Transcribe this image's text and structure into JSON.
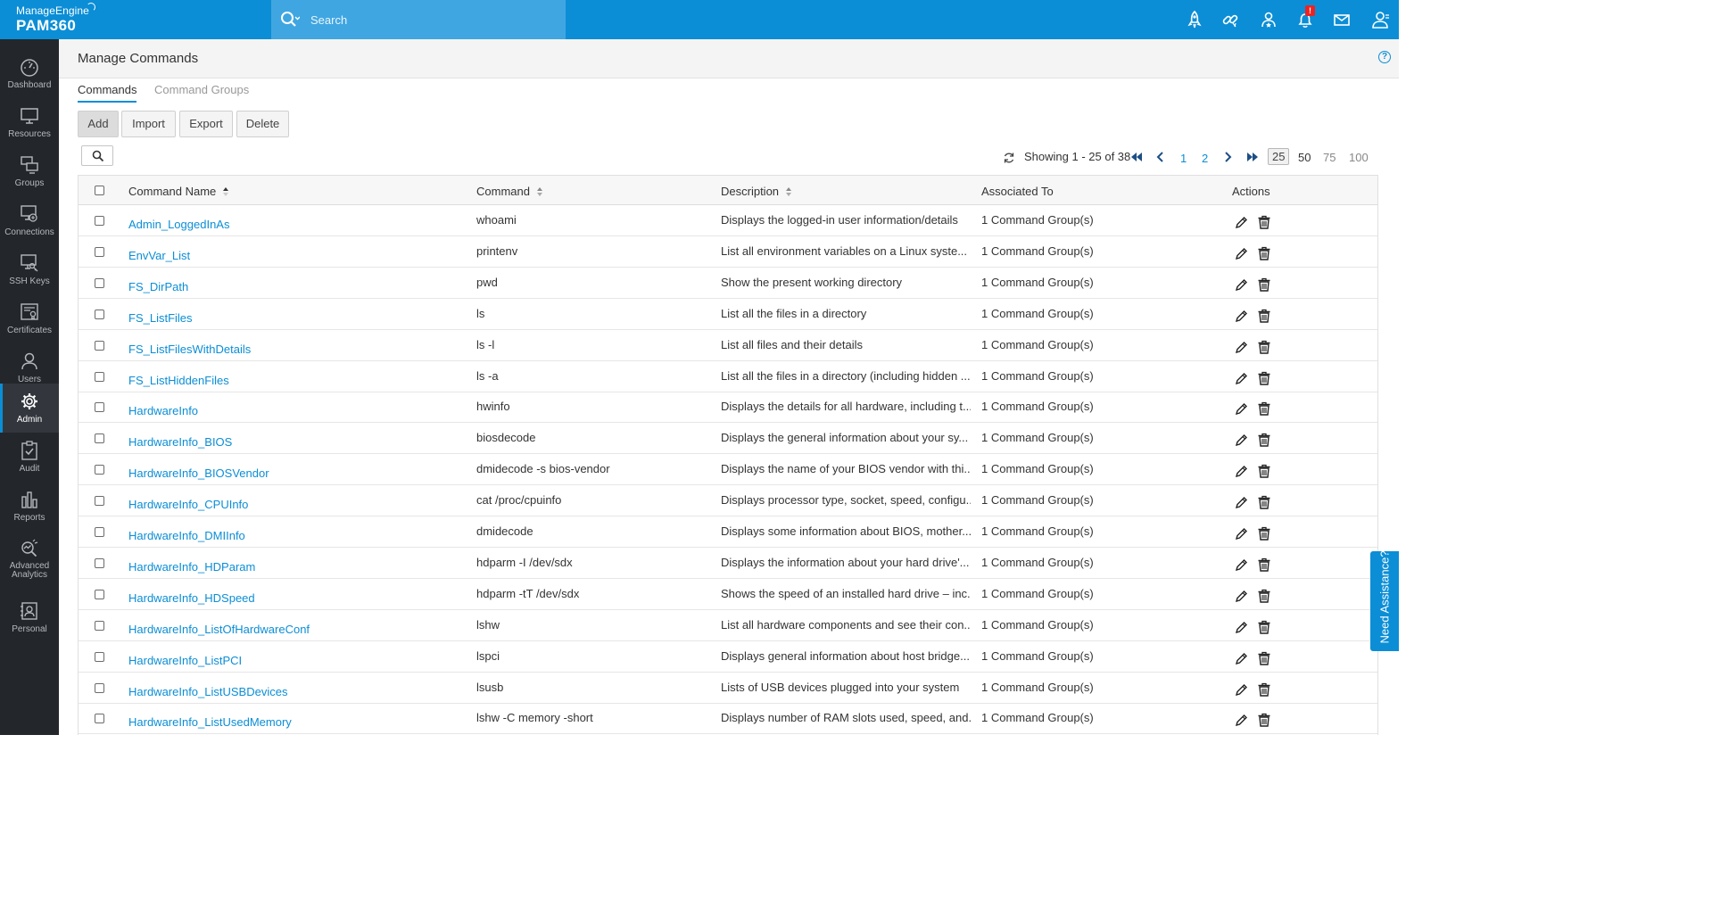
{
  "app": {
    "vendor": "ManageEngine",
    "product": "PAM360",
    "search_placeholder": "Search",
    "notification_count": "!"
  },
  "topbar_icons": [
    "rocket-icon",
    "link-icon",
    "user-star-icon",
    "bell-icon",
    "mail-icon",
    "user-icon"
  ],
  "sidebar": {
    "items": [
      {
        "label": "Dashboard",
        "icon": "dashboard-icon",
        "active": false
      },
      {
        "label": "Resources",
        "icon": "monitor-icon",
        "active": false
      },
      {
        "label": "Groups",
        "icon": "groups-icon",
        "active": false
      },
      {
        "label": "Connections",
        "icon": "connections-icon",
        "active": false
      },
      {
        "label": "SSH Keys",
        "icon": "ssh-keys-icon",
        "active": false
      },
      {
        "label": "Certificates",
        "icon": "certificate-icon",
        "active": false
      },
      {
        "label": "Users",
        "icon": "users-icon",
        "active": false
      },
      {
        "label": "Admin",
        "icon": "gear-icon",
        "active": true
      },
      {
        "label": "Audit",
        "icon": "clipboard-check-icon",
        "active": false
      },
      {
        "label": "Reports",
        "icon": "bar-chart-icon",
        "active": false
      },
      {
        "label": "Advanced Analytics",
        "icon": "analytics-icon",
        "active": false
      },
      {
        "label": "Personal",
        "icon": "personal-icon",
        "active": false
      }
    ]
  },
  "page": {
    "title": "Manage Commands",
    "help": "?",
    "tabs": [
      {
        "label": "Commands",
        "active": true
      },
      {
        "label": "Command Groups",
        "active": false
      }
    ],
    "buttons": {
      "add": "Add",
      "import": "Import",
      "export": "Export",
      "delete": "Delete"
    }
  },
  "pagination": {
    "showing": "Showing 1 - 25 of 38",
    "pages": [
      "1",
      "2"
    ],
    "page_sizes": [
      "25",
      "50",
      "75",
      "100"
    ],
    "current_size": "25"
  },
  "table": {
    "columns": {
      "name": "Command Name",
      "command": "Command",
      "description": "Description",
      "associated": "Associated To",
      "actions": "Actions"
    },
    "rows": [
      {
        "name": "Admin_LoggedInAs",
        "command": "whoami",
        "description": "Displays the logged-in user information/details",
        "associated": "1 Command Group(s)"
      },
      {
        "name": "EnvVar_List",
        "command": "printenv",
        "description": "List all environment variables on a Linux syste...",
        "associated": "1 Command Group(s)"
      },
      {
        "name": "FS_DirPath",
        "command": "pwd",
        "description": "Show the present working directory",
        "associated": "1 Command Group(s)"
      },
      {
        "name": "FS_ListFiles",
        "command": "ls",
        "description": "List all the files in a directory",
        "associated": "1 Command Group(s)"
      },
      {
        "name": "FS_ListFilesWithDetails",
        "command": "ls -l",
        "description": "List all files and their details",
        "associated": "1 Command Group(s)"
      },
      {
        "name": "FS_ListHiddenFiles",
        "command": "ls -a",
        "description": "List all the files in a directory (including hidden ...",
        "associated": "1 Command Group(s)"
      },
      {
        "name": "HardwareInfo",
        "command": "hwinfo",
        "description": "Displays the details for all hardware, including t...",
        "associated": "1 Command Group(s)"
      },
      {
        "name": "HardwareInfo_BIOS",
        "command": "biosdecode",
        "description": "Displays the general information about your sy...",
        "associated": "1 Command Group(s)"
      },
      {
        "name": "HardwareInfo_BIOSVendor",
        "command": "dmidecode -s bios-vendor",
        "description": "Displays the name of your BIOS vendor with thi...",
        "associated": "1 Command Group(s)"
      },
      {
        "name": "HardwareInfo_CPUInfo",
        "command": "cat /proc/cpuinfo",
        "description": "Displays processor type, socket, speed, configu...",
        "associated": "1 Command Group(s)"
      },
      {
        "name": "HardwareInfo_DMIInfo",
        "command": "dmidecode",
        "description": "Displays some information about BIOS, mother...",
        "associated": "1 Command Group(s)"
      },
      {
        "name": "HardwareInfo_HDParam",
        "command": "hdparm -I /dev/sdx",
        "description": "Displays the information about your hard drive'...",
        "associated": "1 Command Group(s)"
      },
      {
        "name": "HardwareInfo_HDSpeed",
        "command": "hdparm -tT /dev/sdx",
        "description": "Shows the speed of an installed hard drive – inc...",
        "associated": "1 Command Group(s)"
      },
      {
        "name": "HardwareInfo_ListOfHardwareConf",
        "command": "lshw",
        "description": "List all hardware components and see their con...",
        "associated": "1 Command Group(s)"
      },
      {
        "name": "HardwareInfo_ListPCI",
        "command": "lspci",
        "description": "Displays general information about host bridge...",
        "associated": "1 Command Group(s)"
      },
      {
        "name": "HardwareInfo_ListUSBDevices",
        "command": "lsusb",
        "description": "Lists of USB devices plugged into your system",
        "associated": "1 Command Group(s)"
      },
      {
        "name": "HardwareInfo_ListUsedMemory",
        "command": "lshw -C memory -short",
        "description": "Displays number of RAM slots used, speed, and...",
        "associated": "1 Command Group(s)"
      }
    ]
  },
  "assistance": {
    "label": "Need Assistance?"
  },
  "colors": {
    "accent": "#0b8ed6",
    "sidebar": "#23262b",
    "alert": "#e22222"
  }
}
